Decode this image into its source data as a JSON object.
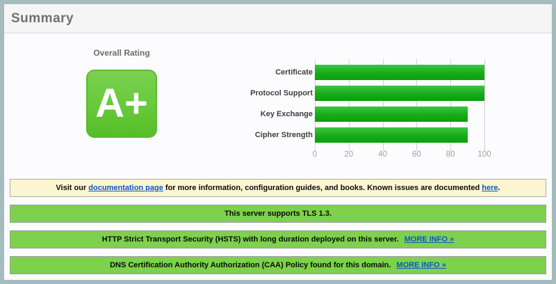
{
  "header": {
    "title": "Summary"
  },
  "rating": {
    "label": "Overall Rating",
    "grade": "A+",
    "grade_color": "#65C92F"
  },
  "chart_data": {
    "type": "bar",
    "orientation": "horizontal",
    "categories": [
      "Certificate",
      "Protocol Support",
      "Key Exchange",
      "Cipher Strength"
    ],
    "values": [
      100,
      100,
      90,
      90
    ],
    "title": "",
    "xlabel": "",
    "ylabel": "",
    "xlim": [
      0,
      100
    ],
    "xticks": [
      0,
      20,
      40,
      60,
      80,
      100
    ],
    "grid": true,
    "bar_color": "#1DB31E"
  },
  "notice": {
    "part1": "Visit our ",
    "link1": "documentation page",
    "part2": " for more information, configuration guides, and books. Known issues are documented ",
    "link2": "here",
    "part3": ".",
    "background": "#FBF5D2"
  },
  "banners": [
    {
      "text": "This server supports TLS 1.3."
    },
    {
      "text": "HTTP Strict Transport Security (HSTS) with long duration deployed on this server.",
      "link": "MORE INFO »"
    },
    {
      "text": "DNS Certification Authority Authorization (CAA) Policy found for this domain.",
      "link": "MORE INFO »"
    }
  ],
  "colors": {
    "frame_border": "#A4BCBD",
    "banner_green": "#7DD14C",
    "link_blue": "#0B56C4",
    "chart_bar_green": "#1DB31E"
  }
}
